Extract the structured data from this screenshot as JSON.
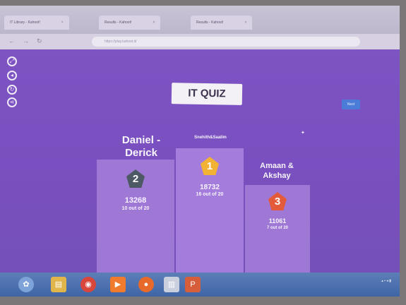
{
  "browser": {
    "tabs": [
      {
        "label": "IT Library - Kahoot!"
      },
      {
        "label": "Results - Kahoot!"
      },
      {
        "label": "Results - Kahoot!"
      }
    ],
    "url": "https://play.kahoot.it/"
  },
  "quiz": {
    "title": "IT QUIZ",
    "next_label": "Next"
  },
  "podium": {
    "first": {
      "name": "Snehith&Saalim",
      "rank": "1",
      "score": "18732",
      "correct": "16 out of 20",
      "color": "#f2b233"
    },
    "second": {
      "name": "Daniel - Derick",
      "rank": "2",
      "score": "13268",
      "correct": "10 out of 20",
      "color": "#4d5a66"
    },
    "third": {
      "name": "Amaan & Akshay",
      "rank": "3",
      "score": "11061",
      "correct": "7 out of 20",
      "color": "#e35b3a"
    }
  },
  "taskbar": {
    "icons": [
      "windows-start-icon",
      "file-explorer-icon",
      "chrome-icon",
      "media-player-icon",
      "firefox-icon",
      "folder-icon",
      "powerpoint-icon"
    ]
  }
}
